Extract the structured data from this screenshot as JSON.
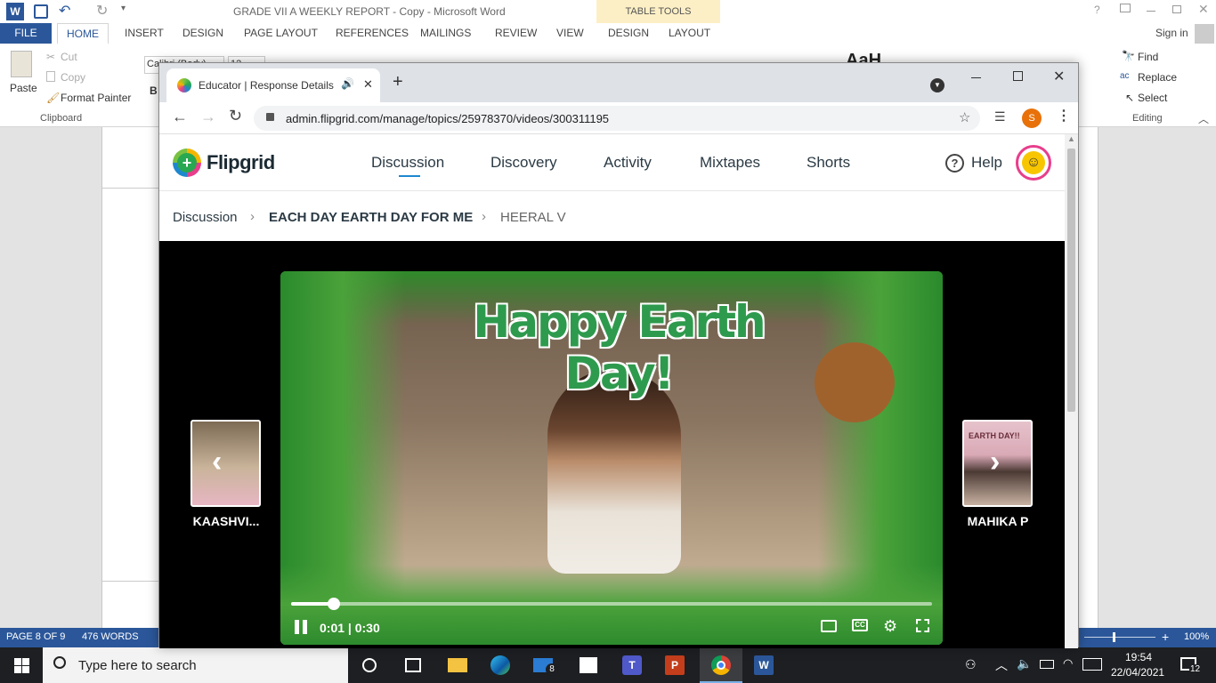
{
  "word": {
    "title": "GRADE VII A WEEKLY REPORT - Copy - Microsoft Word",
    "table_tools": "TABLE TOOLS",
    "tabs": [
      "FILE",
      "HOME",
      "INSERT",
      "DESIGN",
      "PAGE LAYOUT",
      "REFERENCES",
      "MAILINGS",
      "REVIEW",
      "VIEW",
      "DESIGN",
      "LAYOUT"
    ],
    "sign_in": "Sign in",
    "clipboard": {
      "paste": "Paste",
      "cut": "Cut",
      "copy": "Copy",
      "format_painter": "Format Painter",
      "group": "Clipboard"
    },
    "font_name": "Calibri (Body)",
    "font_size": "12",
    "editing": {
      "find": "Find",
      "replace": "Replace",
      "select": "Select",
      "group": "Editing"
    },
    "style_preview": "AaH"
  },
  "statusbar": {
    "page": "PAGE 8 OF 9",
    "words": "476 WORDS",
    "zoom": "100%"
  },
  "taskbar": {
    "search_placeholder": "Type here to search",
    "time": "19:54",
    "date": "22/04/2021",
    "notifications": "12",
    "mail_badge": "8"
  },
  "chrome": {
    "tab_title": "Educator | Response Details",
    "url": "admin.flipgrid.com/manage/topics/25978370/videos/300311195",
    "profile_initial": "S"
  },
  "flipgrid": {
    "logo": "Flipgrid",
    "nav": [
      "Discussion",
      "Discovery",
      "Activity",
      "Mixtapes",
      "Shorts"
    ],
    "help": "Help",
    "breadcrumb": [
      "Discussion",
      "EACH DAY EARTH DAY FOR ME",
      "HEERAL V"
    ],
    "video_banner": "Happy Earth Day!",
    "video_time": "0:01 | 0:30",
    "progress": 0.033,
    "prev_name": "KAASHVI...",
    "next_name": "MAHIKA P",
    "next_thumb_sign": "EARTH DAY!!"
  },
  "colors": {
    "word_blue": "#2b579a",
    "flipgrid_green": "#28a850",
    "accent_blue": "#1d88ce"
  }
}
